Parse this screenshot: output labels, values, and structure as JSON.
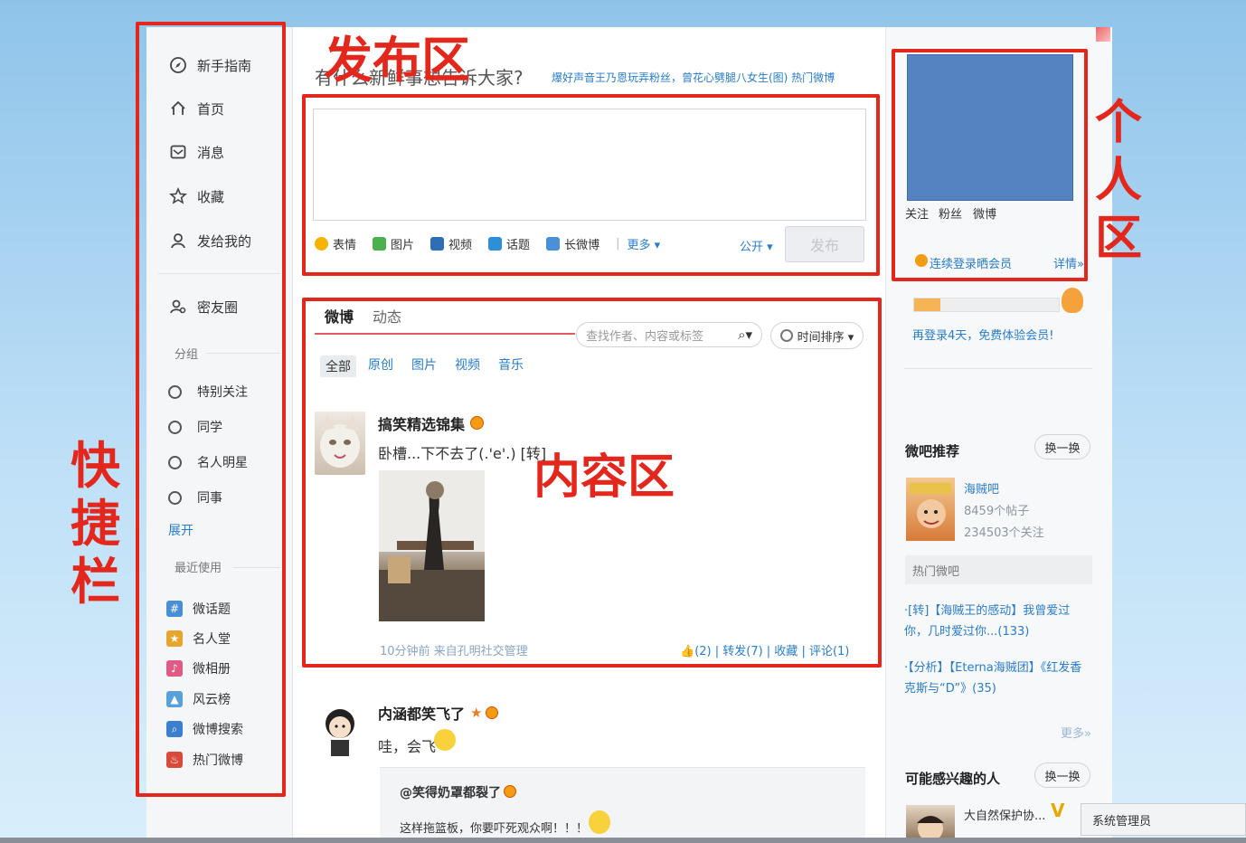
{
  "annotations": {
    "quickbar": [
      "快",
      "捷",
      "栏"
    ],
    "publish": "发布区",
    "personal": [
      "个",
      "人",
      "区"
    ],
    "content": "内容区"
  },
  "sidebar": {
    "nav": [
      {
        "label": "新手指南",
        "icon": "compass-icon"
      },
      {
        "label": "首页",
        "icon": "home-icon"
      },
      {
        "label": "消息",
        "icon": "mail-icon"
      },
      {
        "label": "收藏",
        "icon": "star-icon"
      },
      {
        "label": "发给我的",
        "icon": "user-icon"
      }
    ],
    "friend_circle": "密友圈",
    "group_title": "分组",
    "groups": [
      "特别关注",
      "同学",
      "名人明星",
      "同事"
    ],
    "expand": "展开",
    "recent_title": "最近使用",
    "apps": [
      {
        "label": "微话题",
        "icon": "topic-icon",
        "color": "#4a8fd6"
      },
      {
        "label": "名人堂",
        "icon": "fame-icon",
        "color": "#e8a52b"
      },
      {
        "label": "微相册",
        "icon": "album-icon",
        "color": "#e05a86"
      },
      {
        "label": "风云榜",
        "icon": "ranking-icon",
        "color": "#5aa0d8"
      },
      {
        "label": "微博搜索",
        "icon": "search-app-icon",
        "color": "#3b7fd0"
      },
      {
        "label": "热门微博",
        "icon": "hot-weibo-icon",
        "color": "#d94a3a"
      }
    ]
  },
  "publish": {
    "heading": "有什么新鲜事想告诉大家?",
    "hot_text": "爆好声音王乃恩玩弄粉丝，曾花心劈腿八女生(图)   热门微博",
    "textarea_placeholder": "",
    "tools": [
      {
        "label": "表情",
        "color": "#f4b400"
      },
      {
        "label": "图片",
        "color": "#4caf50"
      },
      {
        "label": "视频",
        "color": "#2f6db5"
      },
      {
        "label": "话题",
        "color": "#2f8fd6"
      },
      {
        "label": "长微博",
        "color": "#4a90d9"
      }
    ],
    "more": "更多 ▾",
    "visibility": "公开 ▾",
    "submit": "发布"
  },
  "content": {
    "tabs": [
      "微博",
      "动态"
    ],
    "search_placeholder": "查找作者、内容或标签",
    "sort": "时间排序 ▾",
    "filters": [
      "全部",
      "原创",
      "图片",
      "视频",
      "音乐"
    ],
    "posts": [
      {
        "name": "搞笑精选锦集",
        "text": "卧槽...下不去了(.'e'.) [转]",
        "meta": "10分钟前    来自孔明社交管理",
        "actions": "(2)  |  转发(7)  |  收藏  |  评论(1)"
      },
      {
        "name": "内涵都笑飞了",
        "text": "哇，会飞",
        "quote_name": "@笑得奶罩都裂了",
        "quote_text": "这样拖篮板，你要吓死观众啊！！！"
      }
    ]
  },
  "right": {
    "stats": [
      "关注",
      "粉丝",
      "微博"
    ],
    "login_member": "连续登录晒会员",
    "details": "详情»",
    "login_more": "再登录4天，免费体验会员!",
    "progress_fraction": 0.18,
    "tieba_title": "微吧推荐",
    "swap": "换一换",
    "tieba_name": "海贼吧",
    "tieba_posts": "8459个帖子",
    "tieba_follow": "234503个关注",
    "hot_tieba": "热门微吧",
    "hot_list": [
      "·[转]【海贼王的感动】我曾爱过你，几时爱过你...(133)",
      "·【分析】【Eterna海贼团】《红发香克斯与“D”》(35)"
    ],
    "more": "更多»",
    "interest_title": "可能感兴趣的人",
    "swap2": "换一换",
    "person_name": "大自然保护协...",
    "vip": "V",
    "admin": "系统管理员"
  }
}
